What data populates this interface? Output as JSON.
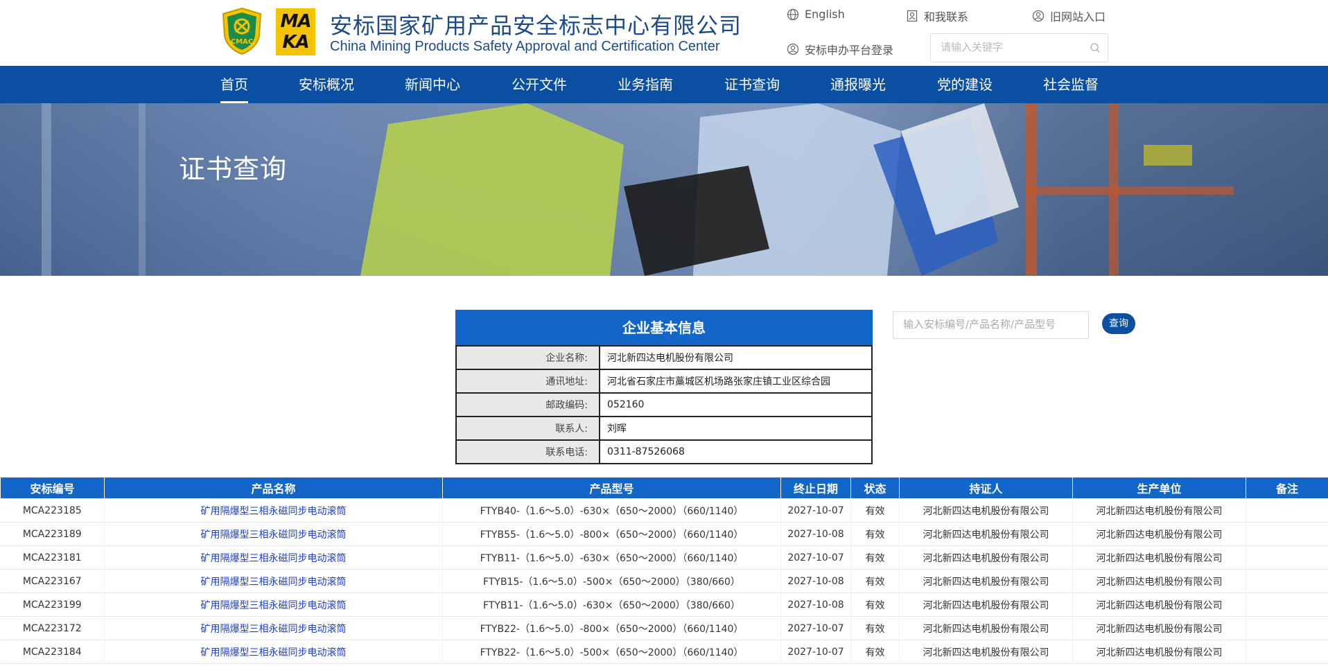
{
  "header": {
    "title_cn": "安标国家矿用产品安全标志中心有限公司",
    "title_en": "China Mining Products Safety Approval and Certification Center",
    "logo_text": "CMAC",
    "logo2_top": "MA",
    "logo2_bottom": "KA",
    "links": {
      "english": "English",
      "contact": "和我联系",
      "old_site": "旧网站入口",
      "login": "安标申办平台登录"
    },
    "search_placeholder": "请输入关键字"
  },
  "nav": {
    "items": [
      "首页",
      "安标概况",
      "新闻中心",
      "公开文件",
      "业务指南",
      "证书查询",
      "通报曝光",
      "党的建设",
      "社会监督"
    ],
    "active": "首页"
  },
  "banner": {
    "title": "证书查询"
  },
  "company": {
    "heading": "企业基本信息",
    "rows": [
      {
        "label": "企业名称:",
        "value": "河北新四达电机股份有限公司"
      },
      {
        "label": "通讯地址:",
        "value": "河北省石家庄市藁城区机场路张家庄镇工业区综合园"
      },
      {
        "label": "邮政编码:",
        "value": "052160"
      },
      {
        "label": "联系人:",
        "value": "刘晖"
      },
      {
        "label": "联系电话:",
        "value": "0311-87526068"
      }
    ]
  },
  "side_search": {
    "placeholder": "输入安标编号/产品名称/产品型号",
    "button": "查询"
  },
  "certificates": {
    "columns": [
      "安标编号",
      "产品名称",
      "产品型号",
      "终止日期",
      "状态",
      "持证人",
      "生产单位",
      "备注"
    ],
    "rows": [
      [
        "MCA223185",
        "矿用隔爆型三相永磁同步电动滚筒",
        "FTYB40-（1.6～5.0）-630×（650～2000）（660/1140）",
        "2027-10-07",
        "有效",
        "河北新四达电机股份有限公司",
        "河北新四达电机股份有限公司",
        ""
      ],
      [
        "MCA223189",
        "矿用隔爆型三相永磁同步电动滚筒",
        "FTYB55-（1.6～5.0）-800×（650～2000）（660/1140）",
        "2027-10-08",
        "有效",
        "河北新四达电机股份有限公司",
        "河北新四达电机股份有限公司",
        ""
      ],
      [
        "MCA223181",
        "矿用隔爆型三相永磁同步电动滚筒",
        "FTYB11-（1.6～5.0）-630×（650～2000）（660/1140）",
        "2027-10-07",
        "有效",
        "河北新四达电机股份有限公司",
        "河北新四达电机股份有限公司",
        ""
      ],
      [
        "MCA223167",
        "矿用隔爆型三相永磁同步电动滚筒",
        "FTYB15-（1.6～5.0）-500×（650～2000）（380/660）",
        "2027-10-08",
        "有效",
        "河北新四达电机股份有限公司",
        "河北新四达电机股份有限公司",
        ""
      ],
      [
        "MCA223199",
        "矿用隔爆型三相永磁同步电动滚筒",
        "FTYB11-（1.6～5.0）-630×（650～2000）（380/660）",
        "2027-10-08",
        "有效",
        "河北新四达电机股份有限公司",
        "河北新四达电机股份有限公司",
        ""
      ],
      [
        "MCA223172",
        "矿用隔爆型三相永磁同步电动滚筒",
        "FTYB22-（1.6～5.0）-800×（650～2000）（660/1140）",
        "2027-10-07",
        "有效",
        "河北新四达电机股份有限公司",
        "河北新四达电机股份有限公司",
        ""
      ],
      [
        "MCA223184",
        "矿用隔爆型三相永磁同步电动滚筒",
        "FTYB22-（1.6～5.0）-500×（650～2000）（660/1140）",
        "2027-10-07",
        "有效",
        "河北新四达电机股份有限公司",
        "河北新四达电机股份有限公司",
        ""
      ]
    ]
  },
  "colors": {
    "nav_bg": "#0b4fa2",
    "table_header_bg": "#1266c8",
    "link_blue": "#1a3ed0",
    "title_blue": "#1a4a8c",
    "logo_yellow": "#f5c400"
  }
}
